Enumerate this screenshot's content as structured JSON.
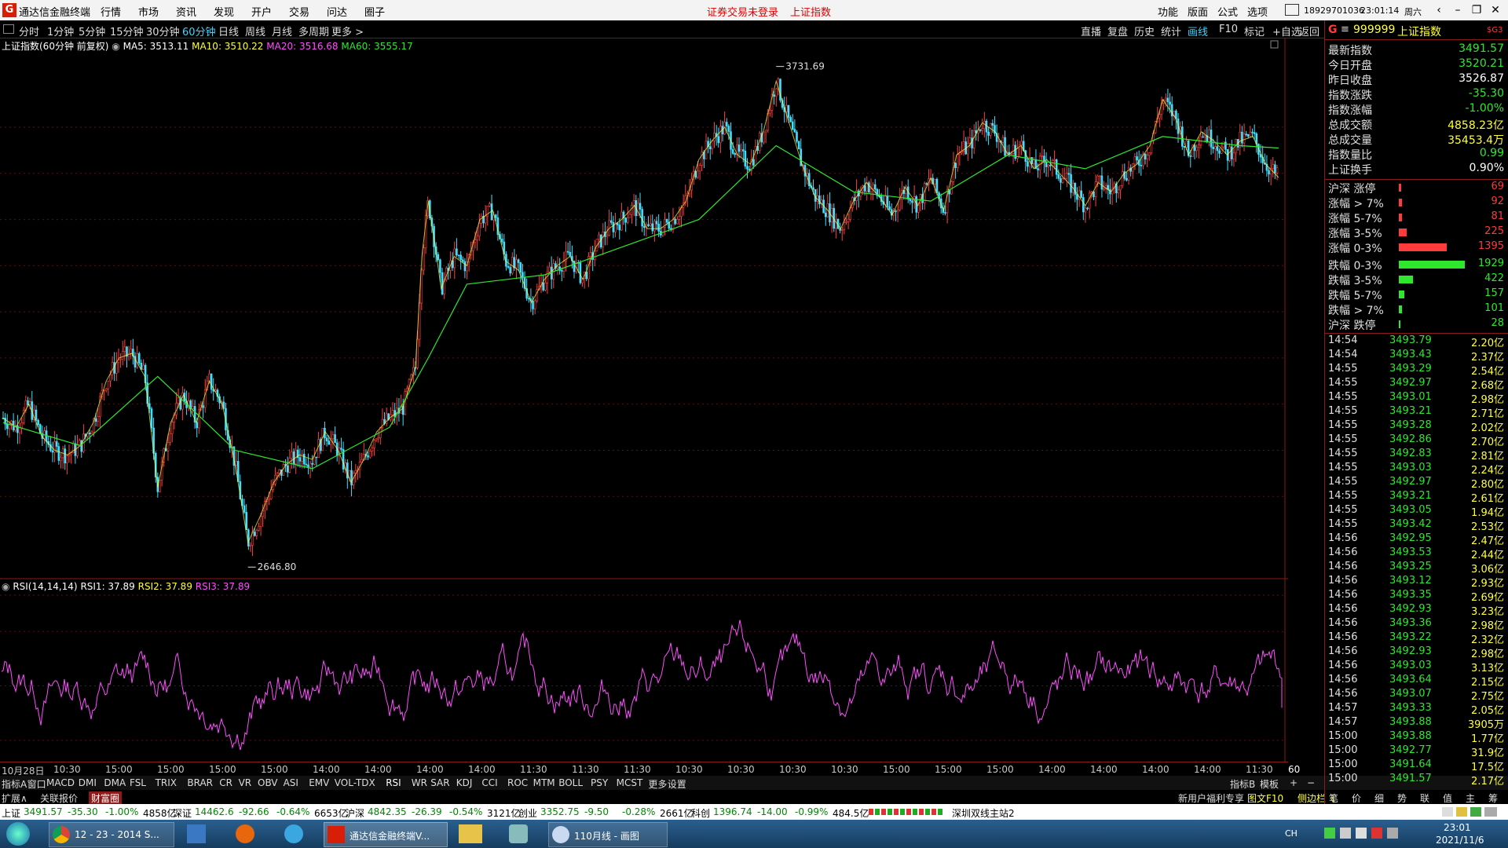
{
  "titlebar": {
    "logo": "G",
    "app_name": "通达信金融终端",
    "menu": [
      "行情",
      "市场",
      "资讯",
      "发现",
      "开户",
      "交易",
      "问达",
      "圈子"
    ],
    "warning": "证券交易未登录",
    "current_index": "上证指数",
    "right_menu": [
      "功能",
      "版面",
      "公式",
      "选项"
    ],
    "account": "18929701036",
    "clock": "23:01:14",
    "weekday": "周六"
  },
  "periods": [
    "分时",
    "1分钟",
    "5分钟",
    "15分钟",
    "30分钟",
    "60分钟",
    "日线",
    "周线",
    "月线",
    "多周期",
    "更多 >"
  ],
  "active_period": "60分钟",
  "top_right_tools": [
    "直播",
    "复盘",
    "历史",
    "统计",
    "画线",
    "F10",
    "标记",
    "+自选",
    "返回"
  ],
  "main_info": {
    "title": "上证指数(60分钟 前复权)",
    "ma5": "MA5: 3513.11",
    "ma10": "MA10: 3510.22",
    "ma20": "MA20: 3516.68",
    "ma60": "MA60: 3555.17",
    "high_label": "3731.69",
    "low_label": "2646.80"
  },
  "price_axis": [
    "3600",
    "3500",
    "3400",
    "3300",
    "3200",
    "3100",
    "3000",
    "2900",
    "2800"
  ],
  "rsi_info": {
    "title": "RSI(14,14,14)",
    "rsi1": "RSI1: 37.89",
    "rsi2": "RSI2: 37.89",
    "rsi3": "RSI3: 37.89"
  },
  "rsi_axis": [
    "100.00",
    "80.00",
    "50.00",
    "20.00"
  ],
  "date_axis": [
    "10月28日",
    "10:30",
    "15:00",
    "15:00",
    "15:00",
    "15:00",
    "14:00",
    "14:00",
    "14:00",
    "14:00",
    "11:30",
    "11:30",
    "11:30",
    "10:30",
    "10:30",
    "10:30",
    "10:30",
    "15:00",
    "15:00",
    "15:00",
    "14:00",
    "14:00",
    "14:00",
    "14:00",
    "11:30"
  ],
  "date_axis_right": "60分钟",
  "indicators": [
    "指标A",
    "窗口",
    "MACD",
    "DMI",
    "DMA",
    "FSL",
    "TRIX",
    "BRAR",
    "CR",
    "VR",
    "OBV",
    "ASI",
    "EMV",
    "VOL-TDX",
    "RSI",
    "WR",
    "SAR",
    "KDJ",
    "CCI",
    "ROC",
    "MTM",
    "BOLL",
    "PSY",
    "MCST",
    "更多",
    "设置"
  ],
  "indicators_right": [
    "指标B",
    "模板",
    "+",
    "−"
  ],
  "ext_bar": [
    "扩展∧",
    "关联报价",
    "财富圈"
  ],
  "ext_bar_right": [
    "新用户福利专享",
    "图文F10",
    "侧边栏《"
  ],
  "side_tabs": [
    "笔",
    "价",
    "细",
    "势",
    "联",
    "值",
    "主",
    "筹"
  ],
  "ticker": [
    {
      "name": "上证",
      "price": "3491.57",
      "chg": "-35.30",
      "pct": "-1.00%",
      "amt": "4858亿"
    },
    {
      "name": "深证",
      "price": "14462.6",
      "chg": "-92.66",
      "pct": "-0.64%",
      "amt": "6653亿"
    },
    {
      "name": "沪深",
      "price": "4842.35",
      "chg": "-26.39",
      "pct": "-0.54%",
      "amt": "3121亿"
    },
    {
      "name": "创业",
      "price": "3352.75",
      "chg": "-9.50",
      "pct": "-0.28%",
      "amt": "2661亿"
    },
    {
      "name": "科创",
      "price": "1396.74",
      "chg": "-14.00",
      "pct": "-0.99%",
      "amt": "484.5亿"
    }
  ],
  "ticker_station": "深圳双线主站2",
  "taskbar": {
    "items": [
      "12 - 23 - 2014 S...",
      "通达信金融终端V...",
      "110月线 - 画图"
    ],
    "ime": "CH",
    "time": "23:01",
    "date": "2021/11/6"
  },
  "quote_panel": {
    "code_prefix": "G",
    "code": "999999",
    "name": "上证指数",
    "tag": "$G3",
    "rows": [
      {
        "label": "最新指数",
        "value": "3491.57",
        "color": "#2ee82e"
      },
      {
        "label": "今日开盘",
        "value": "3520.21",
        "color": "#2ee82e"
      },
      {
        "label": "昨日收盘",
        "value": "3526.87",
        "color": "#ffffff"
      },
      {
        "label": "指数涨跌",
        "value": "-35.30",
        "color": "#2ee82e"
      },
      {
        "label": "指数涨幅",
        "value": "-1.00%",
        "color": "#2ee82e"
      },
      {
        "label": "总成交额",
        "value": "4858.23亿",
        "color": "#ffff3b"
      },
      {
        "label": "总成交量",
        "value": "35453.4万",
        "color": "#ffff3b"
      },
      {
        "label": "指数量比",
        "value": "0.99",
        "color": "#2ee82e"
      },
      {
        "label": "上证换手",
        "value": "0.90%",
        "color": "#ffffff"
      }
    ],
    "breadth": [
      {
        "label": "沪深 涨停",
        "value": "69",
        "count": 69,
        "color": "#ff3b3b"
      },
      {
        "label": "涨幅 > 7%",
        "value": "92",
        "count": 92,
        "color": "#ff3b3b"
      },
      {
        "label": "涨幅 5-7%",
        "value": "81",
        "count": 81,
        "color": "#ff3b3b"
      },
      {
        "label": "涨幅 3-5%",
        "value": "225",
        "count": 225,
        "color": "#ff3b3b"
      },
      {
        "label": "涨幅 0-3%",
        "value": "1395",
        "count": 1395,
        "color": "#ff3b3b"
      },
      {
        "label": "跌幅 0-3%",
        "value": "1929",
        "count": 1929,
        "color": "#2ee82e"
      },
      {
        "label": "跌幅 3-5%",
        "value": "422",
        "count": 422,
        "color": "#2ee82e"
      },
      {
        "label": "跌幅 5-7%",
        "value": "157",
        "count": 157,
        "color": "#2ee82e"
      },
      {
        "label": "跌幅 > 7%",
        "value": "101",
        "count": 101,
        "color": "#2ee82e"
      },
      {
        "label": "沪深 跌停",
        "value": "28",
        "count": 28,
        "color": "#2ee82e"
      }
    ],
    "ticks": [
      [
        "14:54",
        "3493.79",
        "2.20亿"
      ],
      [
        "14:54",
        "3493.43",
        "2.37亿"
      ],
      [
        "14:55",
        "3493.29",
        "2.54亿"
      ],
      [
        "14:55",
        "3492.97",
        "2.68亿"
      ],
      [
        "14:55",
        "3493.01",
        "2.98亿"
      ],
      [
        "14:55",
        "3493.21",
        "2.71亿"
      ],
      [
        "14:55",
        "3493.28",
        "2.02亿"
      ],
      [
        "14:55",
        "3492.86",
        "2.70亿"
      ],
      [
        "14:55",
        "3492.83",
        "2.81亿"
      ],
      [
        "14:55",
        "3493.03",
        "2.24亿"
      ],
      [
        "14:55",
        "3492.97",
        "2.80亿"
      ],
      [
        "14:55",
        "3493.21",
        "2.61亿"
      ],
      [
        "14:55",
        "3493.05",
        "1.94亿"
      ],
      [
        "14:55",
        "3493.42",
        "2.53亿"
      ],
      [
        "14:56",
        "3492.95",
        "2.47亿"
      ],
      [
        "14:56",
        "3493.53",
        "2.44亿"
      ],
      [
        "14:56",
        "3493.25",
        "3.06亿"
      ],
      [
        "14:56",
        "3493.12",
        "2.93亿"
      ],
      [
        "14:56",
        "3493.35",
        "2.69亿"
      ],
      [
        "14:56",
        "3492.93",
        "3.23亿"
      ],
      [
        "14:56",
        "3493.36",
        "2.98亿"
      ],
      [
        "14:56",
        "3493.22",
        "2.32亿"
      ],
      [
        "14:56",
        "3492.93",
        "2.98亿"
      ],
      [
        "14:56",
        "3493.03",
        "3.13亿"
      ],
      [
        "14:56",
        "3493.64",
        "2.15亿"
      ],
      [
        "14:56",
        "3493.07",
        "2.75亿"
      ],
      [
        "14:57",
        "3493.33",
        "2.05亿"
      ],
      [
        "14:57",
        "3493.88",
        "3905万"
      ],
      [
        "15:00",
        "3493.88",
        "1.77亿"
      ],
      [
        "15:00",
        "3492.77",
        "31.9亿"
      ],
      [
        "15:00",
        "3491.64",
        "17.5亿"
      ],
      [
        "15:00",
        "3491.57",
        "2.17亿"
      ]
    ]
  },
  "chart_data": [
    {
      "type": "candlestick",
      "title": "上证指数(60分钟 前复权)",
      "ylim": [
        2620,
        3760
      ],
      "y_ticks": [
        2800,
        2900,
        3000,
        3100,
        3200,
        3300,
        3400,
        3500,
        3600
      ],
      "high": 3731.69,
      "low": 2646.8,
      "close_path": [
        [
          0,
          2970
        ],
        [
          10,
          2950
        ],
        [
          20,
          3000
        ],
        [
          30,
          2930
        ],
        [
          40,
          2900
        ],
        [
          50,
          2890
        ],
        [
          60,
          2910
        ],
        [
          70,
          2960
        ],
        [
          80,
          3050
        ],
        [
          90,
          3100
        ],
        [
          100,
          3110
        ],
        [
          110,
          3060
        ],
        [
          120,
          2820
        ],
        [
          130,
          2960
        ],
        [
          140,
          3020
        ],
        [
          150,
          2960
        ],
        [
          160,
          3050
        ],
        [
          170,
          3000
        ],
        [
          180,
          2870
        ],
        [
          190,
          2700
        ],
        [
          200,
          2760
        ],
        [
          210,
          2830
        ],
        [
          220,
          2870
        ],
        [
          230,
          2890
        ],
        [
          240,
          2880
        ],
        [
          250,
          2940
        ],
        [
          260,
          2900
        ],
        [
          270,
          2830
        ],
        [
          280,
          2880
        ],
        [
          290,
          2940
        ],
        [
          300,
          2970
        ],
        [
          310,
          2990
        ],
        [
          320,
          3080
        ],
        [
          325,
          3320
        ],
        [
          330,
          3440
        ],
        [
          335,
          3350
        ],
        [
          340,
          3250
        ],
        [
          350,
          3320
        ],
        [
          360,
          3300
        ],
        [
          370,
          3400
        ],
        [
          380,
          3420
        ],
        [
          390,
          3310
        ],
        [
          400,
          3290
        ],
        [
          410,
          3220
        ],
        [
          420,
          3270
        ],
        [
          430,
          3300
        ],
        [
          440,
          3320
        ],
        [
          450,
          3270
        ],
        [
          460,
          3340
        ],
        [
          470,
          3380
        ],
        [
          480,
          3400
        ],
        [
          490,
          3430
        ],
        [
          500,
          3380
        ],
        [
          510,
          3380
        ],
        [
          520,
          3400
        ],
        [
          530,
          3440
        ],
        [
          540,
          3530
        ],
        [
          550,
          3570
        ],
        [
          560,
          3600
        ],
        [
          570,
          3540
        ],
        [
          580,
          3520
        ],
        [
          590,
          3590
        ],
        [
          600,
          3700
        ],
        [
          610,
          3610
        ],
        [
          620,
          3520
        ],
        [
          630,
          3450
        ],
        [
          640,
          3420
        ],
        [
          650,
          3380
        ],
        [
          660,
          3440
        ],
        [
          670,
          3480
        ],
        [
          680,
          3450
        ],
        [
          690,
          3410
        ],
        [
          700,
          3470
        ],
        [
          710,
          3430
        ],
        [
          720,
          3490
        ],
        [
          730,
          3420
        ],
        [
          740,
          3540
        ],
        [
          750,
          3560
        ],
        [
          760,
          3610
        ],
        [
          770,
          3590
        ],
        [
          780,
          3540
        ],
        [
          790,
          3560
        ],
        [
          800,
          3510
        ],
        [
          810,
          3530
        ],
        [
          820,
          3500
        ],
        [
          830,
          3470
        ],
        [
          840,
          3430
        ],
        [
          850,
          3480
        ],
        [
          860,
          3460
        ],
        [
          870,
          3500
        ],
        [
          880,
          3520
        ],
        [
          890,
          3560
        ],
        [
          900,
          3660
        ],
        [
          910,
          3620
        ],
        [
          920,
          3540
        ],
        [
          930,
          3590
        ],
        [
          940,
          3570
        ],
        [
          950,
          3540
        ],
        [
          960,
          3570
        ],
        [
          970,
          3580
        ],
        [
          980,
          3520
        ],
        [
          990,
          3491
        ]
      ],
      "ma": [
        [
          0,
          2960
        ],
        [
          60,
          2910
        ],
        [
          120,
          3060
        ],
        [
          180,
          2900
        ],
        [
          240,
          2860
        ],
        [
          300,
          2950
        ],
        [
          330,
          3100
        ],
        [
          360,
          3260
        ],
        [
          420,
          3280
        ],
        [
          480,
          3340
        ],
        [
          540,
          3400
        ],
        [
          600,
          3560
        ],
        [
          660,
          3460
        ],
        [
          720,
          3440
        ],
        [
          780,
          3540
        ],
        [
          840,
          3510
        ],
        [
          900,
          3580
        ],
        [
          960,
          3560
        ],
        [
          990,
          3555
        ]
      ]
    },
    {
      "type": "line",
      "title": "RSI(14,14,14)",
      "ylim": [
        10,
        100
      ],
      "y_ticks": [
        20,
        50,
        80,
        100
      ],
      "series_value": 37.89
    }
  ]
}
